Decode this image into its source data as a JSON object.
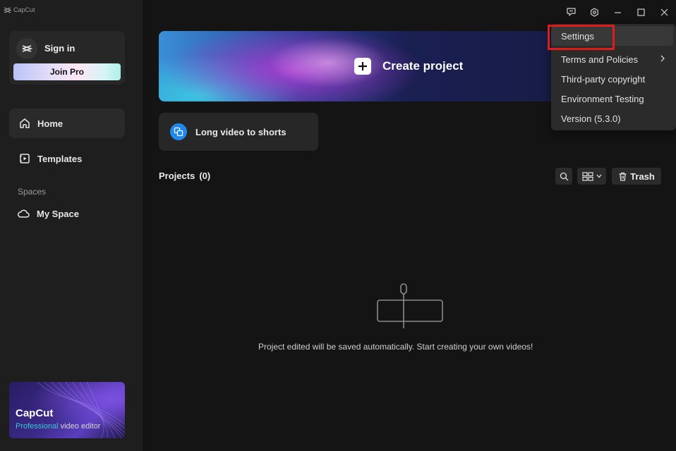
{
  "app": {
    "brand": "CapCut"
  },
  "sidebar": {
    "sign_in": "Sign in",
    "join_pro": "Join Pro",
    "nav": [
      {
        "label": "Home",
        "icon": "home-icon",
        "active": true
      },
      {
        "label": "Templates",
        "icon": "templates-icon",
        "active": false
      }
    ],
    "spaces_label": "Spaces",
    "my_space": {
      "label": "My Space",
      "icon": "cloud-icon"
    },
    "promo": {
      "title": "CapCut",
      "subtitle_accent": "Professional",
      "subtitle_rest": " video editor"
    }
  },
  "window_controls": [
    "feedback-icon",
    "settings-gear-icon",
    "minimize-icon",
    "maximize-icon",
    "close-icon"
  ],
  "main": {
    "create_project": "Create project",
    "long_video_to_shorts": "Long video to shorts",
    "projects_title": "Projects",
    "projects_count": "(0)",
    "trash_label": "Trash",
    "empty_message": "Project edited will be saved automatically. Start creating your own videos!"
  },
  "menu": {
    "items": [
      {
        "label": "Settings",
        "highlighted": true
      },
      {
        "label": "Terms and Policies",
        "has_submenu": true
      },
      {
        "label": "Third-party copyright"
      },
      {
        "label": "Environment Testing"
      },
      {
        "label": "Version (5.3.0)"
      }
    ]
  },
  "colors": {
    "background": "#141414",
    "sidebar": "#1e1e1e",
    "card": "#272727",
    "accent_blue": "#1e8af0",
    "highlight_red": "#e01b1b"
  }
}
